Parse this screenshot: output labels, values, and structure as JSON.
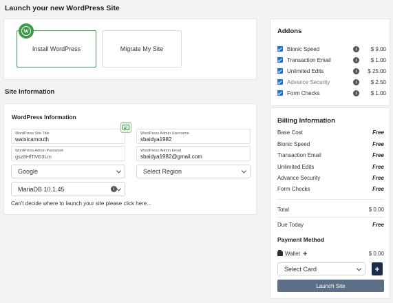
{
  "page": {
    "title": "Launch your new WordPress Site"
  },
  "install_options": {
    "install_label": "Install WordPress",
    "migrate_label": "Migrate My Site"
  },
  "site_information": {
    "section_title": "Site Information",
    "card_title": "WordPress Information",
    "site_title": {
      "label": "WordPress Site Title",
      "value": "watsicamouth"
    },
    "admin_username": {
      "label": "WordPress Admin Username",
      "value": "sbaidya1982"
    },
    "admin_password": {
      "label": "WordPress Admin Password",
      "value": "gsz8HfTM03Lm"
    },
    "admin_email": {
      "label": "WordPress Admin Email",
      "value": "sbaidya1982@gmail.com"
    },
    "provider_select": "Google",
    "region_select": "Select Region",
    "database_select": "MariaDB 10.1.45",
    "hint_text": "Can't decide where to launch your site please",
    "hint_link": "click here..."
  },
  "addons": {
    "title": "Addons",
    "items": [
      {
        "name": "Bionic Speed",
        "price": "$ 9.00",
        "checked": true
      },
      {
        "name": "Transaction Email",
        "price": "$ 1.00",
        "checked": true
      },
      {
        "name": "Unlimited Edits",
        "price": "$ 25.00",
        "checked": true
      },
      {
        "name": "Advance Security",
        "price": "$ 2.50",
        "checked": true
      },
      {
        "name": "Form Checks",
        "price": "$ 1.00",
        "checked": true
      }
    ]
  },
  "billing": {
    "title": "Billing Information",
    "rows": [
      {
        "label": "Base Cost",
        "value": "Free"
      },
      {
        "label": "Bionic Speed",
        "value": "Free"
      },
      {
        "label": "Transaction Email",
        "value": "Free"
      },
      {
        "label": "Unlimited Edits",
        "value": "Free"
      },
      {
        "label": "Advance Security",
        "value": "Free"
      },
      {
        "label": "Form Checks",
        "value": "Free"
      }
    ],
    "total_label": "Total",
    "total_value": "$ 0.00",
    "due_label": "Due Today",
    "due_value": "Free",
    "payment_title": "Payment Method",
    "wallet_label": "Wallet",
    "wallet_amount": "$ 0.00",
    "card_select": "Select Card",
    "add_card_symbol": "+",
    "launch_label": "Launch Site"
  },
  "colors": {
    "accent_green": "#3c9a4a",
    "checkbox_blue": "#1a73e8",
    "launch_button": "#5c6f86",
    "add_button": "#1d2b4a"
  }
}
